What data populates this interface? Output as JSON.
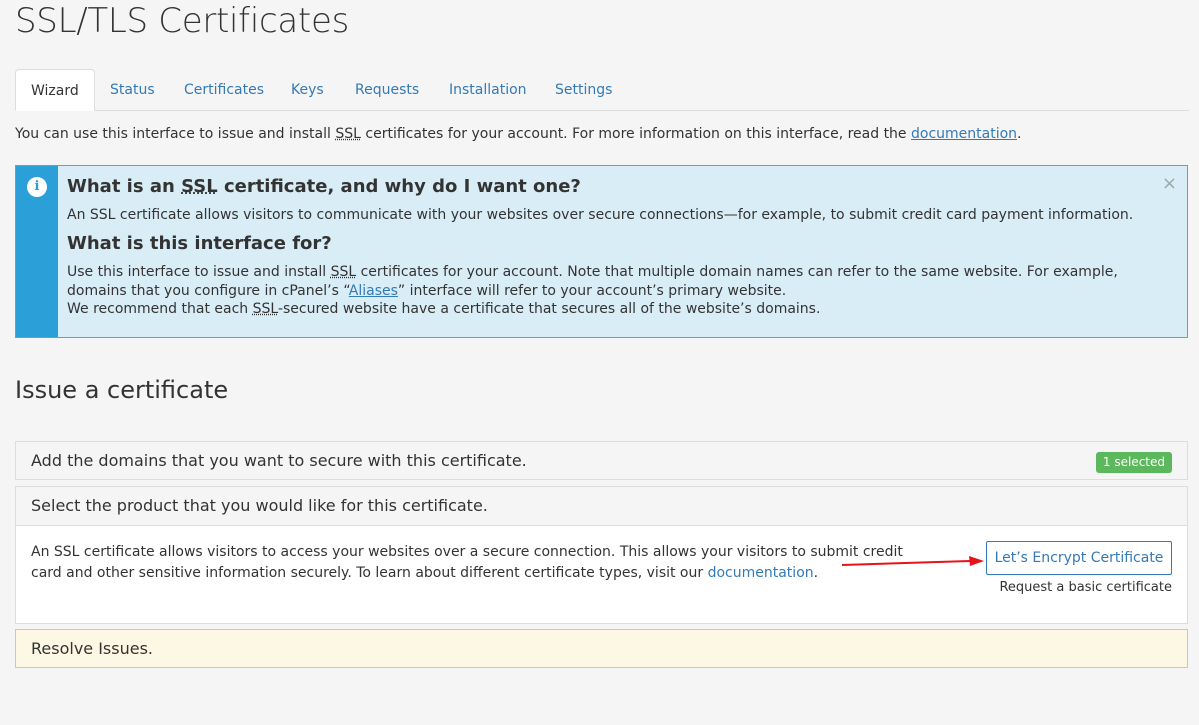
{
  "page": {
    "title": "SSL/TLS Certificates"
  },
  "tabs": [
    {
      "label": "Wizard",
      "active": true
    },
    {
      "label": "Status"
    },
    {
      "label": "Certificates"
    },
    {
      "label": "Keys"
    },
    {
      "label": "Requests"
    },
    {
      "label": "Installation"
    },
    {
      "label": "Settings"
    }
  ],
  "intro": {
    "text_a": "You can use this interface to issue and install ",
    "ssl": "SSL",
    "text_b": " certificates for your account. For more information on this interface, read the ",
    "link": "documentation",
    "text_c": "."
  },
  "info_alert": {
    "icon": "info-icon",
    "close": "×",
    "h1_a": "What is an ",
    "h1_ssl": "SSL",
    "h1_b": " certificate, and why do I want one?",
    "p1": "An SSL certificate allows visitors to communicate with your websites over secure connections—for example, to submit credit card payment information.",
    "h2": "What is this interface for?",
    "p2_a": "Use this interface to issue and install ",
    "p2_ssl": "SSL",
    "p2_b": " certificates for your account. Note that multiple domain names can refer to the same website. For example, domains that you configure in cPanel’s “",
    "p2_link": "Aliases",
    "p2_c": "” interface will refer to your account’s primary website.",
    "p3_a": "We recommend that each ",
    "p3_ssl": "SSL",
    "p3_b": "-secured website have a certificate that secures all of the website’s domains."
  },
  "issue": {
    "heading": "Issue a certificate",
    "domains_panel": {
      "title": "Add the domains that you want to secure with this certificate.",
      "badge": "1 selected"
    },
    "product_panel": {
      "title": "Select the product that you would like for this certificate.",
      "desc_a": "An SSL certificate allows visitors to access your websites over a secure connection. This allows your visitors to submit credit card and other sensitive information securely. To learn about different certificate types, visit our ",
      "desc_link": "documentation",
      "desc_b": ".",
      "button": "Let’s Encrypt Certificate",
      "button_sub": "Request a basic certificate"
    },
    "resolve_panel": {
      "title": "Resolve Issues."
    }
  },
  "colors": {
    "link": "#337ab7",
    "info_rail": "#2a9fd8",
    "info_bg": "#d9edf7",
    "badge": "#5cb85c",
    "warning_bg": "#fcf8e3",
    "annotation_arrow": "#e8121a"
  }
}
